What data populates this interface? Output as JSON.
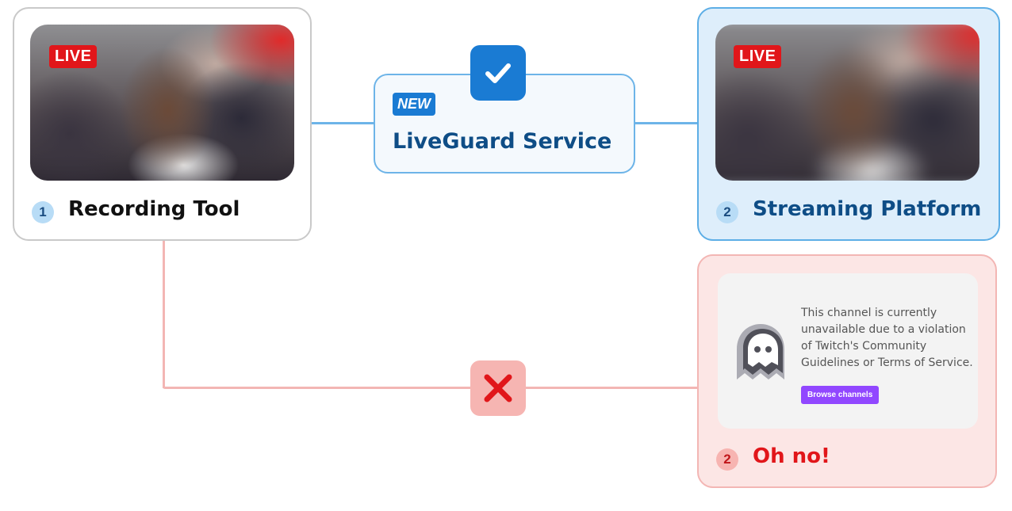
{
  "source": {
    "live_label": "LIVE",
    "step": "1",
    "title": "Recording Tool"
  },
  "service": {
    "badge": "NEW",
    "title": "LiveGuard Service"
  },
  "platform": {
    "live_label": "LIVE",
    "step": "2",
    "title": "Streaming Platform"
  },
  "failure": {
    "step": "2",
    "title": "Oh no!",
    "ban_message": "This channel is currently unavailable due to a violation of Twitch's Community Guidelines or Terms of Service.",
    "button_label": "Browse channels"
  },
  "icons": {
    "check": "checkmark-icon",
    "cross": "x-icon",
    "ghost": "ghost-icon"
  },
  "colors": {
    "blue_accent": "#1a7bd3",
    "red_accent": "#e1161a",
    "twitch_purple": "#9147ff"
  }
}
